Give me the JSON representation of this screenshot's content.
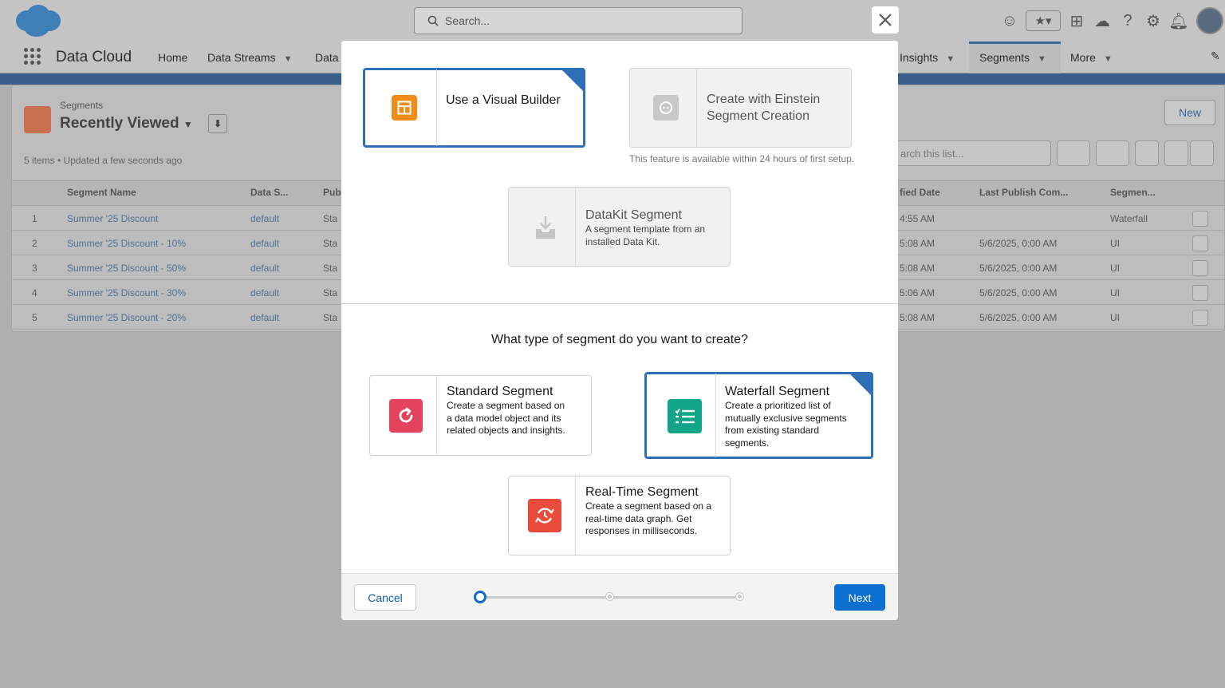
{
  "header": {
    "search_placeholder": "Search...",
    "app_name": "Data Cloud",
    "nav": [
      {
        "label": "Home"
      },
      {
        "label": "Data Streams"
      },
      {
        "label": "Data"
      },
      {
        "label": "Insights"
      },
      {
        "label": "Segments"
      },
      {
        "label": "More"
      }
    ]
  },
  "background": {
    "object_label": "Segments",
    "list_title": "Recently Viewed",
    "list_meta": "5 items • Updated a few seconds ago",
    "new_label": "New",
    "search_placeholder": "arch this list...",
    "columns": [
      "Segment Name",
      "Data S...",
      "Pub",
      "fied Date",
      "Last Publish Com...",
      "Segmen..."
    ],
    "rows": [
      {
        "num": "1",
        "name": "Summer '25 Discount",
        "ds": "default",
        "pub": "Sta",
        "date": "4:55 AM",
        "last": "",
        "type": "Waterfall"
      },
      {
        "num": "2",
        "name": "Summer '25 Discount - 10%",
        "ds": "default",
        "pub": "Sta",
        "date": "5:08 AM",
        "last": "5/6/2025, 0:00 AM",
        "type": "UI"
      },
      {
        "num": "3",
        "name": "Summer '25 Discount - 50%",
        "ds": "default",
        "pub": "Sta",
        "date": "5:08 AM",
        "last": "5/6/2025, 0:00 AM",
        "type": "UI"
      },
      {
        "num": "4",
        "name": "Summer '25 Discount - 30%",
        "ds": "default",
        "pub": "Sta",
        "date": "5:06 AM",
        "last": "5/6/2025, 0:00 AM",
        "type": "UI"
      },
      {
        "num": "5",
        "name": "Summer '25 Discount - 20%",
        "ds": "default",
        "pub": "Sta",
        "date": "5:08 AM",
        "last": "5/6/2025, 0:00 AM",
        "type": "UI"
      }
    ]
  },
  "modal": {
    "builders": {
      "visual": {
        "title": "Use a Visual Builder",
        "icon": "layout-icon"
      },
      "einstein": {
        "title": "Create with Einstein Segment Creation",
        "note": "This feature is available within 24 hours of first setup.",
        "icon": "einstein-bot-icon"
      },
      "datakit": {
        "title": "DataKit Segment",
        "desc": "A segment template from an installed Data Kit.",
        "icon": "download-tray-icon"
      }
    },
    "question": "What type of segment do you want to create?",
    "types": {
      "standard": {
        "title": "Standard Segment",
        "desc": "Create a segment based on a data model object and its related objects and insights.",
        "icon": "refresh-icon"
      },
      "waterfall": {
        "title": "Waterfall Segment",
        "desc": "Create a prioritized list of mutually exclusive segments from existing standard segments.",
        "icon": "list-icon"
      },
      "realtime": {
        "title": "Real-Time Segment",
        "desc": "Create a segment based on a real-time data graph. Get responses in milliseconds.",
        "icon": "realtime-icon"
      }
    },
    "footer": {
      "cancel_label": "Cancel",
      "next_label": "Next",
      "progress_step": 1,
      "progress_total": 3
    }
  },
  "colors": {
    "accent": "#0b6fd0",
    "selected_border": "#2f6fb8",
    "visual_builder_icon": "#f08c1a",
    "standard_icon": "#e3435c",
    "waterfall_icon": "#13a58a",
    "realtime_icon": "#ea4b3b"
  }
}
